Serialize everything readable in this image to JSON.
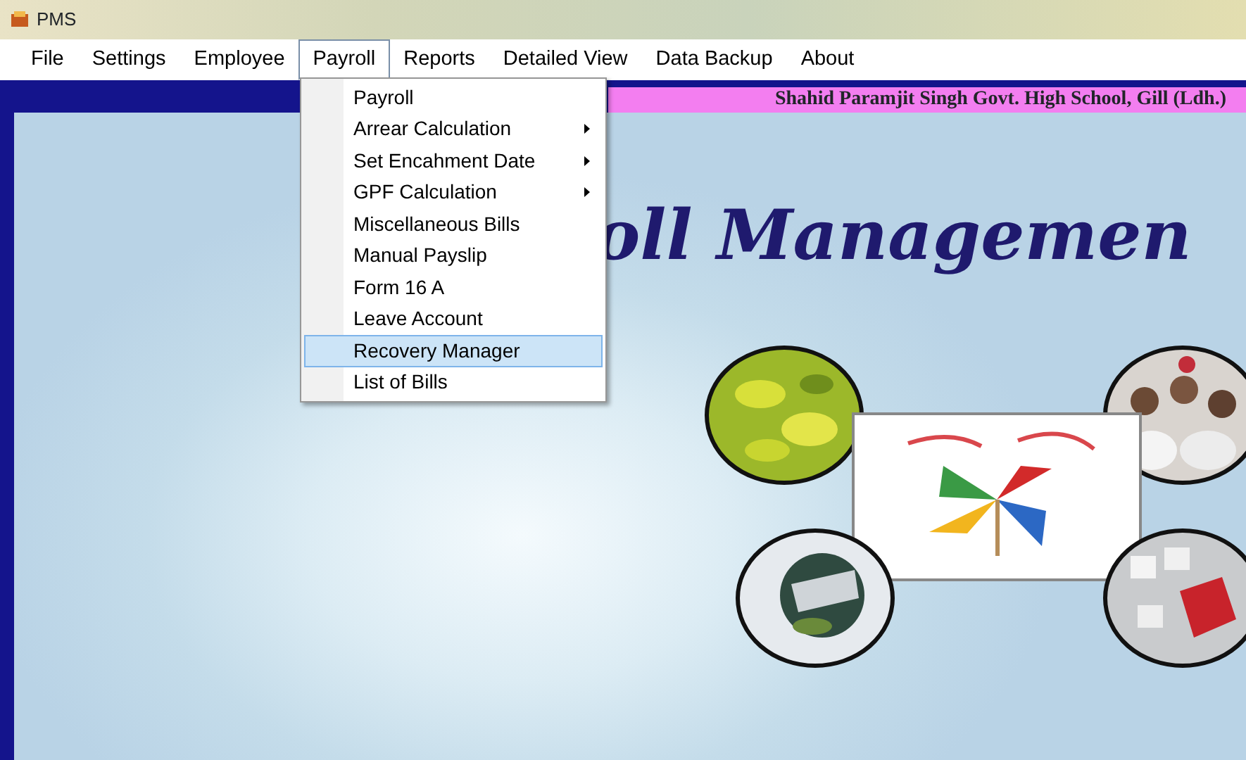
{
  "window": {
    "title": "PMS"
  },
  "menu_bar": [
    {
      "label": "File",
      "selected": false
    },
    {
      "label": "Settings",
      "selected": false
    },
    {
      "label": "Employee",
      "selected": false
    },
    {
      "label": "Payroll",
      "selected": true
    },
    {
      "label": "Reports",
      "selected": false
    },
    {
      "label": "Detailed View",
      "selected": false
    },
    {
      "label": "Data Backup",
      "selected": false
    },
    {
      "label": "About",
      "selected": false
    }
  ],
  "dropdown": [
    {
      "label": "Payroll",
      "submenu": false,
      "selected": false
    },
    {
      "label": "Arrear Calculation",
      "submenu": true,
      "selected": false
    },
    {
      "label": "Set Encahment Date",
      "submenu": true,
      "selected": false
    },
    {
      "label": "GPF Calculation",
      "submenu": true,
      "selected": false
    },
    {
      "label": "Miscellaneous Bills",
      "submenu": false,
      "selected": false
    },
    {
      "label": "Manual Payslip",
      "submenu": false,
      "selected": false
    },
    {
      "label": "Form 16 A",
      "submenu": false,
      "selected": false
    },
    {
      "label": "Leave Account",
      "submenu": false,
      "selected": false
    },
    {
      "label": "Recovery Manager",
      "submenu": false,
      "selected": true
    },
    {
      "label": "List of Bills",
      "submenu": false,
      "selected": false
    }
  ],
  "banner": {
    "text": "Shahid Paramjit Singh Govt. High School, Gill (Ldh.)"
  },
  "heading": "oll Managemen",
  "collage": [
    {
      "kind": "field"
    },
    {
      "kind": "crowd"
    },
    {
      "kind": "logo"
    },
    {
      "kind": "globe"
    },
    {
      "kind": "keyboard"
    }
  ]
}
